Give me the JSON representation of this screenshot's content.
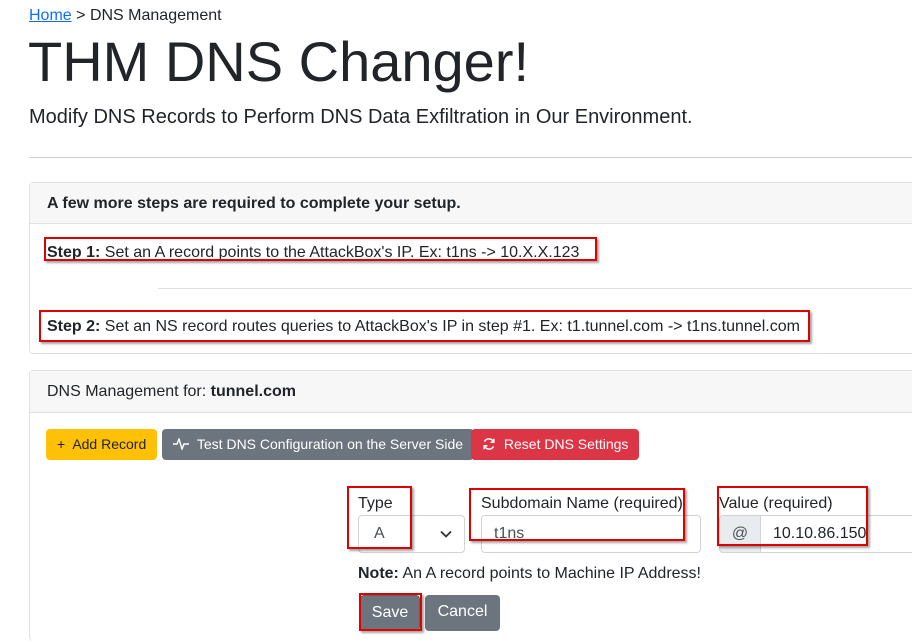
{
  "breadcrumb": {
    "home": "Home",
    "separator": ">",
    "current": "DNS Management"
  },
  "header": {
    "title": "THM DNS Changer!",
    "lead": "Modify DNS Records to Perform DNS Data Exfiltration in Our Environment."
  },
  "setup": {
    "heading": "A few more steps are required to complete your setup.",
    "step1_label": "Step 1:",
    "step1_text": "Set an A record points to the AttackBox's IP. Ex: t1ns -> 10.X.X.123",
    "step2_label": "Step 2:",
    "step2_text": "Set an NS record routes queries to AttackBox's IP in step #1. Ex: t1.tunnel.com -> t1ns.tunnel.com"
  },
  "dns": {
    "header_prefix": "DNS Management for:",
    "domain": "tunnel.com",
    "add_record": "Add Record",
    "test_config": "Test DNS Configuration on the Server Side",
    "reset": "Reset DNS Settings",
    "type_label": "Type",
    "type_value": "A",
    "subdomain_label": "Subdomain Name (required)",
    "subdomain_value": "t1ns",
    "value_label": "Value (required)",
    "value_prefix": "@",
    "value_value": "10.10.86.150",
    "note_label": "Note:",
    "note_text": "An A record points to Machine IP Address!",
    "save": "Save",
    "cancel": "Cancel"
  },
  "icons": {
    "add": "plus-icon",
    "test": "pulse-icon",
    "reset": "refresh-icon",
    "select": "chevron-down-icon"
  },
  "colors": {
    "link": "#0d6efd",
    "warning": "#ffc107",
    "secondary": "#6c757d",
    "danger": "#dc3545",
    "highlight": "#e00000"
  }
}
